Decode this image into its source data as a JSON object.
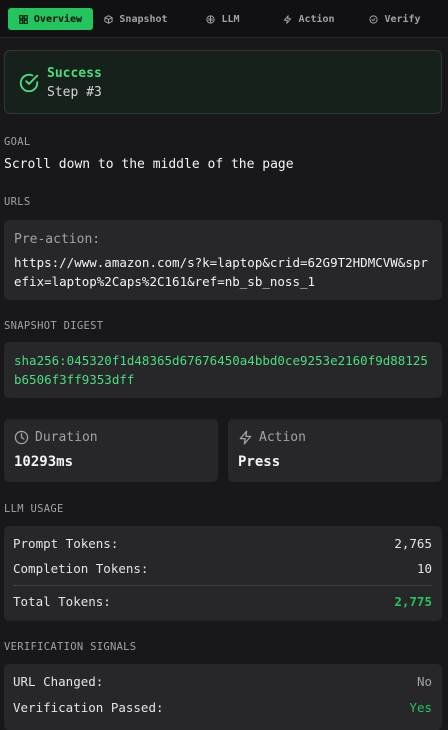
{
  "tabs": [
    {
      "label": "Overview",
      "icon": "grid-icon",
      "active": true
    },
    {
      "label": "Snapshot",
      "icon": "box-icon",
      "active": false
    },
    {
      "label": "LLM",
      "icon": "brain-icon",
      "active": false
    },
    {
      "label": "Action",
      "icon": "zap-icon",
      "active": false
    },
    {
      "label": "Verify",
      "icon": "check-circle-icon",
      "active": false
    }
  ],
  "status": {
    "title": "Success",
    "subtitle": "Step #3",
    "icon": "check-circle-icon",
    "color": "#4ade80"
  },
  "goal": {
    "label": "GOAL",
    "text": "Scroll down to the middle of the page"
  },
  "urls": {
    "label": "URLS",
    "pre_action_label": "Pre-action:",
    "pre_action_url": "https://www.amazon.com/s?k=laptop&crid=62G9T2HDMCVW&sprefix=laptop%2Caps%2C161&ref=nb_sb_noss_1"
  },
  "snapshot": {
    "label": "SNAPSHOT DIGEST",
    "digest": "sha256:045320f1d48365d67676450a4bbd0ce9253e2160f9d88125b6506f3ff9353dff"
  },
  "duration": {
    "label": "Duration",
    "value": "10293ms",
    "icon": "clock-icon"
  },
  "action": {
    "label": "Action",
    "value": "Press",
    "icon": "zap-icon"
  },
  "llm_usage": {
    "label": "LLM USAGE",
    "prompt_label": "Prompt Tokens:",
    "prompt_value": "2,765",
    "completion_label": "Completion Tokens:",
    "completion_value": "10",
    "total_label": "Total Tokens:",
    "total_value": "2,775"
  },
  "verification": {
    "label": "VERIFICATION SIGNALS",
    "url_changed_label": "URL Changed:",
    "url_changed_value": "No",
    "passed_label": "Verification Passed:",
    "passed_value": "Yes"
  },
  "colors": {
    "accent": "#22c55e",
    "background": "#18181b",
    "card": "#27272a"
  }
}
